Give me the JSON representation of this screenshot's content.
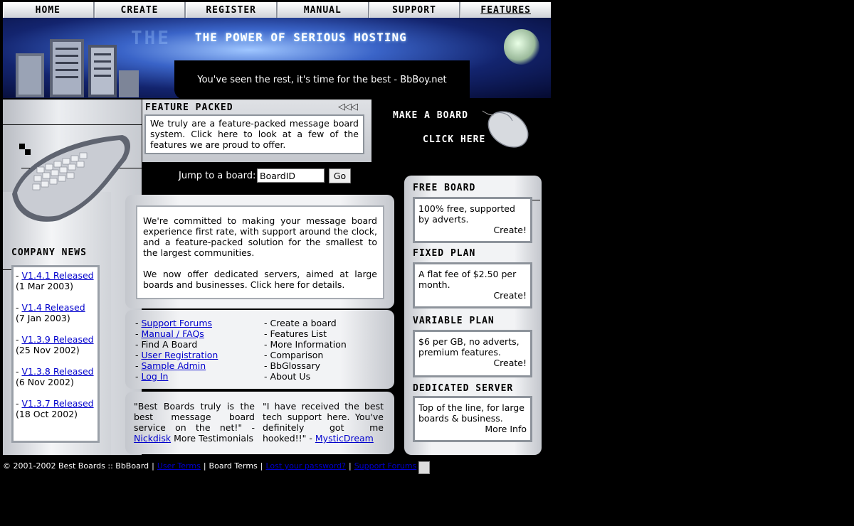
{
  "nav": {
    "tabs": [
      {
        "label": "Home"
      },
      {
        "label": "Create"
      },
      {
        "label": "Register"
      },
      {
        "label": "Manual"
      },
      {
        "label": "Support"
      },
      {
        "label": "Features"
      }
    ]
  },
  "banner": {
    "slogan": "The Power of Serious Hosting",
    "ghost_text": "THE",
    "tagline": "You've seen the rest, it's time for the best - BbBoy.net"
  },
  "feature_packed": {
    "title": "Feature Packed",
    "arrows": "◁◁◁",
    "text": "We truly are a feature-packed message board system. Click here to look at a few of the features we are proud to offer."
  },
  "make_board": {
    "line1": "Make a Board",
    "line2": "Click Here"
  },
  "jump": {
    "label": "Jump to a board:",
    "input_value": "BoardID",
    "button": "Go"
  },
  "company_news": {
    "title": "Company News",
    "items": [
      {
        "link": "V1.4.1 Released",
        "date": "(1 Mar 2003)"
      },
      {
        "link": "V1.4 Released",
        "date": "(7 Jan 2003)"
      },
      {
        "link": "V1.3.9 Released",
        "date": "(25 Nov 2002)"
      },
      {
        "link": "V1.3.8 Released",
        "date": "(6 Nov 2002)"
      },
      {
        "link": "V1.3.7 Released",
        "date": "(18 Oct 2002)"
      }
    ]
  },
  "intro": {
    "p1": "We're committed to making your message board experience first rate, with support around the clock, and a feature-packed solution for the smallest to the largest communities.",
    "p2": "We now offer dedicated servers, aimed at large boards and businesses. Click here for details."
  },
  "links_left": [
    {
      "text": "Support Forums",
      "link": true
    },
    {
      "text": "Manual / FAQs",
      "link": true
    },
    {
      "text": "Find A Board",
      "link": false
    },
    {
      "text": "User Registration",
      "link": true
    },
    {
      "text": "Sample Admin",
      "link": true
    },
    {
      "text": "Log In",
      "link": true
    }
  ],
  "links_right": [
    {
      "text": "Create a board"
    },
    {
      "text": "Features List"
    },
    {
      "text": "More Information"
    },
    {
      "text": "Comparison"
    },
    {
      "text": "BbGlossary"
    },
    {
      "text": "About Us"
    }
  ],
  "testimonials": {
    "t1_quote": "\"Best Boards truly is the best message board service on the net!\" -",
    "t1_author": "Nickdisk",
    "t1_more": "More Testimonials",
    "t2_quote": "\"I have received the best tech support here. You've definitely got me hooked!!\" -",
    "t2_author": "MysticDream"
  },
  "plans": [
    {
      "title": "Free Board",
      "text": "100% free, supported by adverts.",
      "cta": "Create!"
    },
    {
      "title": "Fixed Plan",
      "text": "A flat fee of $2.50 per month.",
      "cta": "Create!"
    },
    {
      "title": "Variable Plan",
      "text": "$6 per GB, no adverts, premium features.",
      "cta": "Create!"
    },
    {
      "title": "Dedicated Server",
      "text": "Top of the line, for large boards & business.",
      "cta": "More Info"
    }
  ],
  "footer": {
    "copyright": "© 2001-2002 Best Boards :: BbBoard",
    "user_terms": "User Terms",
    "board_terms": "Board Terms",
    "lost_password": "Lost your password?",
    "support_forums": "Support Forums"
  }
}
